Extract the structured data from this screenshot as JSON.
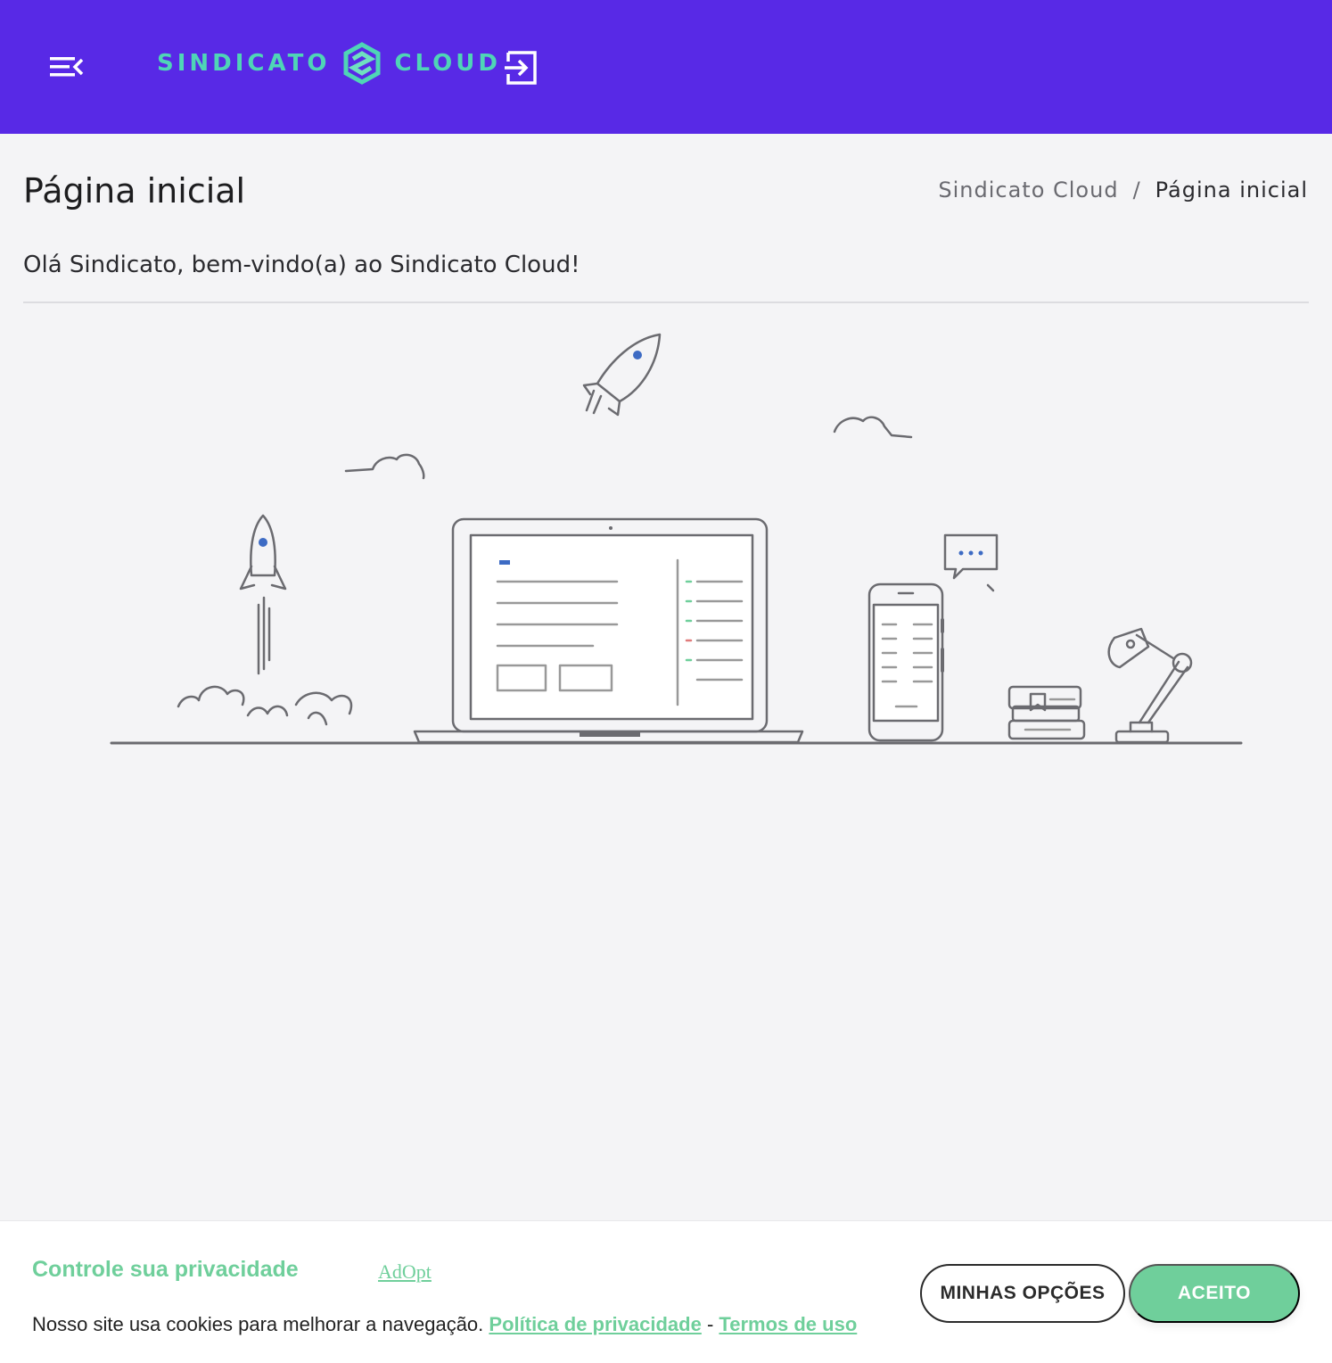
{
  "header": {
    "logo_left": "SINDICATO",
    "logo_right": "CLOUD",
    "menu_icon": "menu-collapse-icon",
    "logout_icon": "logout-icon",
    "colors": {
      "bar": "#5829e6",
      "logo": "#4fd5b6"
    }
  },
  "page": {
    "title": "Página inicial",
    "breadcrumb": {
      "root": "Sindicato Cloud",
      "separator": "/",
      "current": "Página inicial"
    },
    "welcome": "Olá Sindicato, bem-vindo(a) ao Sindicato Cloud!"
  },
  "cookie": {
    "title": "Controle sua privacidade",
    "brand_link": "AdOpt",
    "message": "Nosso site usa cookies para melhorar a navegação.",
    "privacy_link": "Política de privacidade",
    "link_separator": "-",
    "terms_link": "Termos de uso",
    "options_button": "MINHAS OPÇÕES",
    "accept_button": "ACEITO",
    "accent_color": "#6fcf9b"
  }
}
